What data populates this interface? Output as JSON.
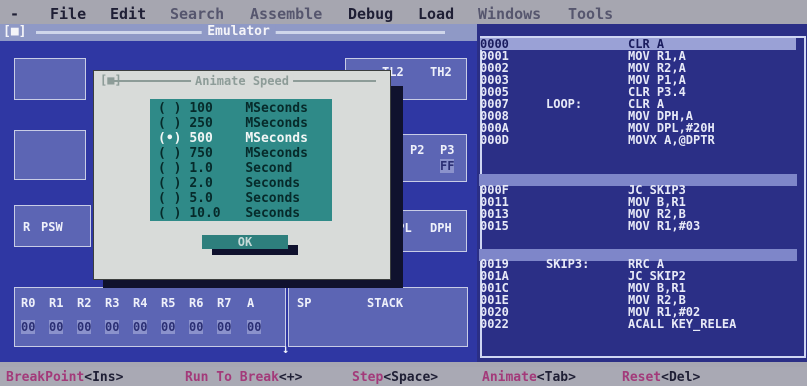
{
  "menu": [
    {
      "label": "-",
      "dim": false
    },
    {
      "label": "File",
      "dim": false
    },
    {
      "label": "Edit",
      "dim": false
    },
    {
      "label": "Search",
      "dim": true
    },
    {
      "label": "Assemble",
      "dim": true
    },
    {
      "label": "Debug",
      "dim": false
    },
    {
      "label": "Load",
      "dim": false
    },
    {
      "label": "Windows",
      "dim": true
    },
    {
      "label": "Tools",
      "dim": true
    }
  ],
  "emulator": {
    "title": "Emulator",
    "close_glyph": "[■]",
    "registers": {
      "tl2": "TL2",
      "th2": "TH2",
      "p2": "P2",
      "p3": "P3",
      "p3_val": "FF",
      "psw_r": "R",
      "psw": "PSW",
      "dpl": "DPL",
      "dph": "DPH",
      "bank": [
        "R0",
        "R1",
        "R2",
        "R3",
        "R4",
        "R5",
        "R6",
        "R7",
        "A"
      ],
      "bank_vals": [
        "00",
        "00",
        "00",
        "00",
        "00",
        "00",
        "00",
        "00",
        "00"
      ],
      "sp": "SP",
      "stack": "STACK",
      "stack_arrow": "↓"
    }
  },
  "code": {
    "lines": [
      {
        "addr": "0000",
        "label": "",
        "instr": "CLR A",
        "selected": true
      },
      {
        "addr": "0001",
        "label": "",
        "instr": "MOV R1,A",
        "selected": false
      },
      {
        "addr": "0002",
        "label": "",
        "instr": "MOV R2,A",
        "selected": false
      },
      {
        "addr": "0003",
        "label": "",
        "instr": "MOV P1,A",
        "selected": false
      },
      {
        "addr": "0005",
        "label": "",
        "instr": "CLR P3.4",
        "selected": false
      },
      {
        "addr": "0007",
        "label": "LOOP:",
        "instr": "CLR A",
        "selected": false
      },
      {
        "addr": "0008",
        "label": "",
        "instr": "MOV DPH,A",
        "selected": false
      },
      {
        "addr": "000A",
        "label": "",
        "instr": "MOV DPL,#20H",
        "selected": false
      },
      {
        "addr": "000D",
        "label": "",
        "instr": "MOVX A,@DPTR",
        "selected": false
      },
      {
        "addr": "000F",
        "label": "",
        "instr": "JC SKIP3",
        "selected": false
      },
      {
        "addr": "0011",
        "label": "",
        "instr": "MOV B,R1",
        "selected": false
      },
      {
        "addr": "0013",
        "label": "",
        "instr": "MOV R2,B",
        "selected": false
      },
      {
        "addr": "0015",
        "label": "",
        "instr": "MOV R1,#03",
        "selected": false
      },
      {
        "addr": "0019",
        "label": "SKIP3:",
        "instr": "RRC A",
        "selected": false
      },
      {
        "addr": "001A",
        "label": "",
        "instr": "JC SKIP2",
        "selected": false
      },
      {
        "addr": "001C",
        "label": "",
        "instr": "MOV B,R1",
        "selected": false
      },
      {
        "addr": "001E",
        "label": "",
        "instr": "MOV R2,B",
        "selected": false
      },
      {
        "addr": "0020",
        "label": "",
        "instr": "MOV R1,#02",
        "selected": false
      },
      {
        "addr": "0022",
        "label": "",
        "instr": "ACALL KEY_RELEA",
        "selected": false
      }
    ]
  },
  "dialog": {
    "title": "Animate Speed",
    "close_glyph": "[■]",
    "options": [
      {
        "value": "100",
        "unit": "MSeconds",
        "selected": false
      },
      {
        "value": "250",
        "unit": "MSeconds",
        "selected": false
      },
      {
        "value": "500",
        "unit": "MSeconds",
        "selected": true
      },
      {
        "value": "750",
        "unit": "MSeconds",
        "selected": false
      },
      {
        "value": "1.0",
        "unit": "Second",
        "selected": false
      },
      {
        "value": "2.0",
        "unit": "Seconds",
        "selected": false
      },
      {
        "value": "5.0",
        "unit": "Seconds",
        "selected": false
      },
      {
        "value": "10.0",
        "unit": "Seconds",
        "selected": false
      }
    ],
    "ok_label": "OK"
  },
  "status": [
    {
      "cmd": "BreakPoint",
      "key": "<Ins>"
    },
    {
      "cmd": "Run To Break",
      "key": "<+>"
    },
    {
      "cmd": "Step",
      "key": "<Space>"
    },
    {
      "cmd": "Animate",
      "key": "<Tab>"
    },
    {
      "cmd": "Reset",
      "key": "<Del>"
    }
  ]
}
